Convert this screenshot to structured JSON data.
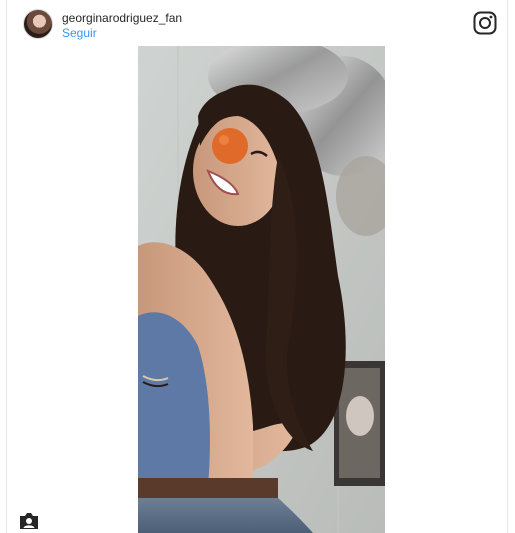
{
  "post": {
    "username": "georginarodriguez_fan",
    "follow_label": "Seguir"
  },
  "icons": {
    "avatar": "profile-avatar",
    "brand": "instagram-icon",
    "tagged_people": "user-tag-icon"
  },
  "colors": {
    "link": "#3897f0",
    "text": "#262626"
  }
}
